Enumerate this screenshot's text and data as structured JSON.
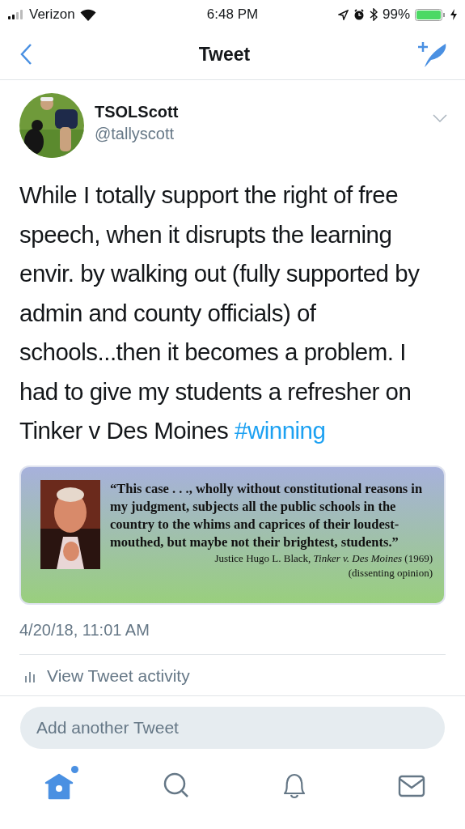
{
  "status_bar": {
    "carrier": "Verizon",
    "time": "6:48 PM",
    "battery": "99%"
  },
  "nav": {
    "title": "Tweet"
  },
  "tweet": {
    "author": {
      "name": "TSOLScott",
      "handle": "@tallyscott"
    },
    "text": "While I totally support the right of free speech, when it disrupts the learning envir. by walking out (fully supported by admin and county officials) of schools...then it becomes a problem. I had to give my students a refresher on Tinker v Des Moines",
    "hashtag": "#winning",
    "media": {
      "quote": "“This case . . ., wholly without constitutional reasons in my judgment, subjects all the public schools in the country to the whims and caprices of their loudest-mouthed, but maybe not their brightest, students.”",
      "attribution": "Justice Hugo L. Black, *Tinker v. Des Moines* (1969)",
      "note": "(dissenting opinion)"
    },
    "timestamp": "4/20/18, 11:01 AM",
    "activity": "View Tweet activity"
  },
  "reply": {
    "placeholder": "Add another Tweet"
  },
  "tab_bar": [
    {
      "kind": "home",
      "selected": true,
      "badge": true
    },
    {
      "kind": "search",
      "selected": false,
      "badge": false
    },
    {
      "kind": "notifications",
      "selected": false,
      "badge": false
    },
    {
      "kind": "messages",
      "selected": false,
      "badge": false
    }
  ]
}
